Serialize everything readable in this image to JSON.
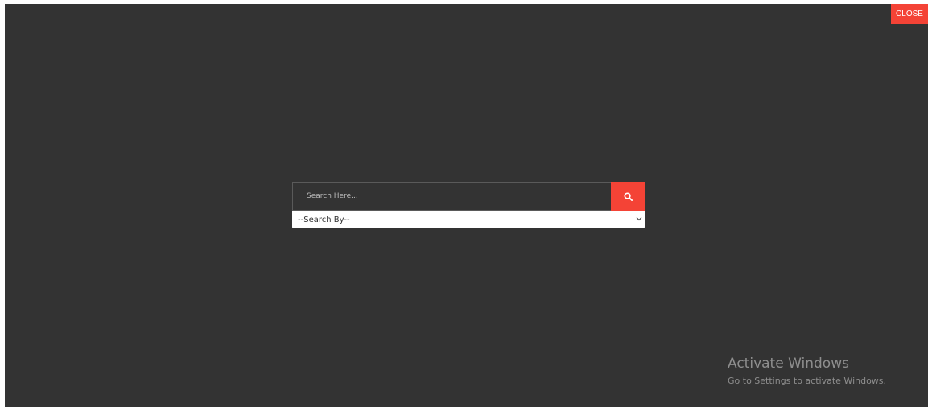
{
  "overlay": {
    "close_label": "CLOSE"
  },
  "search": {
    "placeholder": "Search Here...",
    "icon": "search-icon",
    "search_by": {
      "selected": "--Search By--",
      "icon": "chevron-down-icon"
    }
  },
  "watermark": {
    "title": "Activate Windows",
    "subtitle": "Go to Settings to activate Windows."
  },
  "colors": {
    "background": "#333333",
    "accent": "#f44336",
    "dropdown_bg": "#ffffff"
  }
}
